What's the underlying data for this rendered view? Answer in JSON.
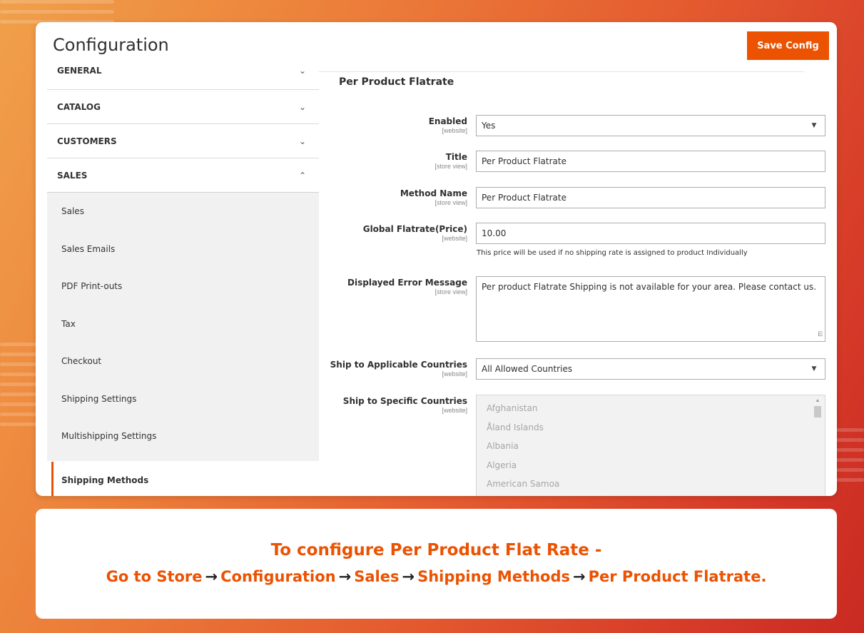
{
  "page": {
    "title": "Configuration",
    "save_label": "Save Config",
    "accent": "#eb5202"
  },
  "sidebar": {
    "sections": [
      {
        "label": "GENERAL",
        "state": "collapsed"
      },
      {
        "label": "CATALOG",
        "state": "collapsed"
      },
      {
        "label": "CUSTOMERS",
        "state": "collapsed"
      },
      {
        "label": "SALES",
        "state": "expanded"
      }
    ],
    "sales_items": [
      "Sales",
      "Sales Emails",
      "PDF Print-outs",
      "Tax",
      "Checkout",
      "Shipping Settings",
      "Multishipping Settings"
    ],
    "active_item": "Shipping Methods"
  },
  "form": {
    "section_title": "Per Product Flatrate",
    "enabled": {
      "label": "Enabled",
      "scope": "[website]",
      "value": "Yes"
    },
    "title": {
      "label": "Title",
      "scope": "[store view]",
      "value": "Per Product Flatrate"
    },
    "method_name": {
      "label": "Method Name",
      "scope": "[store view]",
      "value": "Per Product Flatrate"
    },
    "global_flatrate": {
      "label": "Global Flatrate(Price)",
      "scope": "[website]",
      "value": "10.00",
      "note": "This price will be used if no shipping rate is assigned to product Individually"
    },
    "error_message": {
      "label": "Displayed Error Message",
      "scope": "[store view]",
      "value": "Per product Flatrate Shipping is not available for your area. Please contact us."
    },
    "applicable_countries": {
      "label": "Ship to Applicable Countries",
      "scope": "[website]",
      "value": "All Allowed Countries"
    },
    "specific_countries": {
      "label": "Ship to Specific Countries",
      "scope": "[website]",
      "options": [
        "Afghanistan",
        "Åland Islands",
        "Albania",
        "Algeria",
        "American Samoa"
      ]
    }
  },
  "banner": {
    "line1": "To configure Per Product Flat Rate -",
    "path": [
      "Go to Store",
      "Configuration",
      "Sales",
      "Shipping Methods",
      "Per Product Flatrate."
    ],
    "arrow": "→"
  }
}
